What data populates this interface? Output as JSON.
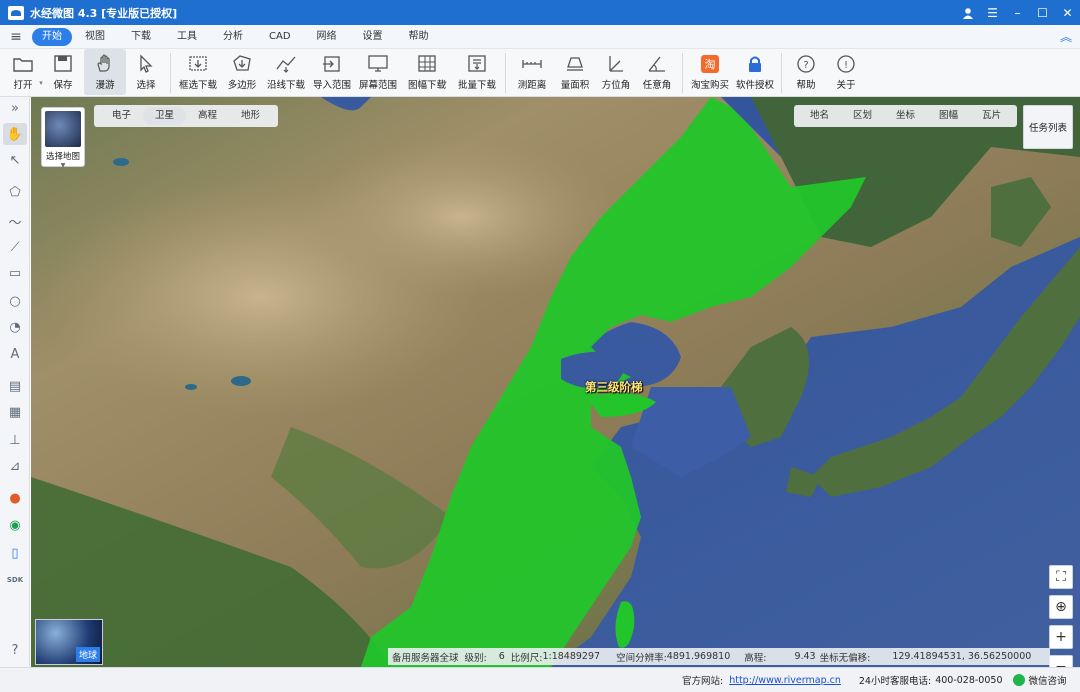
{
  "window": {
    "title": "水经微图 4.3 [专业版已授权]",
    "buttons": [
      "user-icon",
      "menu-icon",
      "minimize-icon",
      "maximize-icon",
      "close-icon"
    ]
  },
  "menu": {
    "items": [
      "开始",
      "视图",
      "下载",
      "工具",
      "分析",
      "CAD",
      "网络",
      "设置",
      "帮助"
    ],
    "active": "开始"
  },
  "toolbar": {
    "items": [
      {
        "label": "打开",
        "icon": "folder-icon",
        "dropdown": true
      },
      {
        "label": "保存",
        "icon": "save-icon"
      },
      {
        "label": "漫游",
        "icon": "hand-icon",
        "active": true
      },
      {
        "label": "选择",
        "icon": "cursor-icon"
      },
      {
        "label": "框选下载",
        "icon": "rect-download-icon"
      },
      {
        "label": "多边形",
        "icon": "polygon-download-icon"
      },
      {
        "label": "沿线下载",
        "icon": "line-download-icon"
      },
      {
        "label": "导入范围",
        "icon": "import-range-icon"
      },
      {
        "label": "屏幕范围",
        "icon": "screen-range-icon"
      },
      {
        "label": "图幅下载",
        "icon": "sheet-download-icon",
        "dropdown": true
      },
      {
        "label": "批量下载",
        "icon": "batch-download-icon"
      },
      {
        "label": "测距离",
        "icon": "measure-distance-icon"
      },
      {
        "label": "量面积",
        "icon": "measure-area-icon"
      },
      {
        "label": "方位角",
        "icon": "azimuth-icon"
      },
      {
        "label": "任意角",
        "icon": "angle-icon"
      },
      {
        "label": "淘宝购买",
        "icon": "taobao-icon"
      },
      {
        "label": "软件授权",
        "icon": "lock-icon"
      },
      {
        "label": "帮助",
        "icon": "help-icon"
      },
      {
        "label": "关于",
        "icon": "info-icon"
      }
    ]
  },
  "map": {
    "base_thumb_label": "选择地图",
    "base_tabs": [
      "电子",
      "卫星",
      "高程",
      "地形"
    ],
    "base_tabs_active": "卫星",
    "overlay_tabs": [
      "地名",
      "区划",
      "坐标",
      "图幅",
      "瓦片"
    ],
    "task_list_label": "任务列表",
    "region_label": "第三级阶梯",
    "globe_label": "地球",
    "colors": {
      "region": "#22c52a",
      "sea": "#3f5fa8",
      "land": "#8b7c58"
    }
  },
  "status": {
    "server": "备用服务器全球",
    "level_label": "级别:",
    "level": "6",
    "scale_label": "比例尺:",
    "scale": "1:18489297",
    "resolution_label": "空间分辨率:",
    "resolution": "4891.969810",
    "elevation_label": "高程:",
    "elevation": "9.43",
    "coord_label": "坐标无偏移:",
    "coords": "129.41894531, 36.56250000"
  },
  "footer": {
    "website_label": "官方网站:",
    "website": "http://www.rivermap.cn",
    "phone_label": "24小时客服电话:",
    "phone": "400-028-0050",
    "wechat": "微信咨询"
  }
}
